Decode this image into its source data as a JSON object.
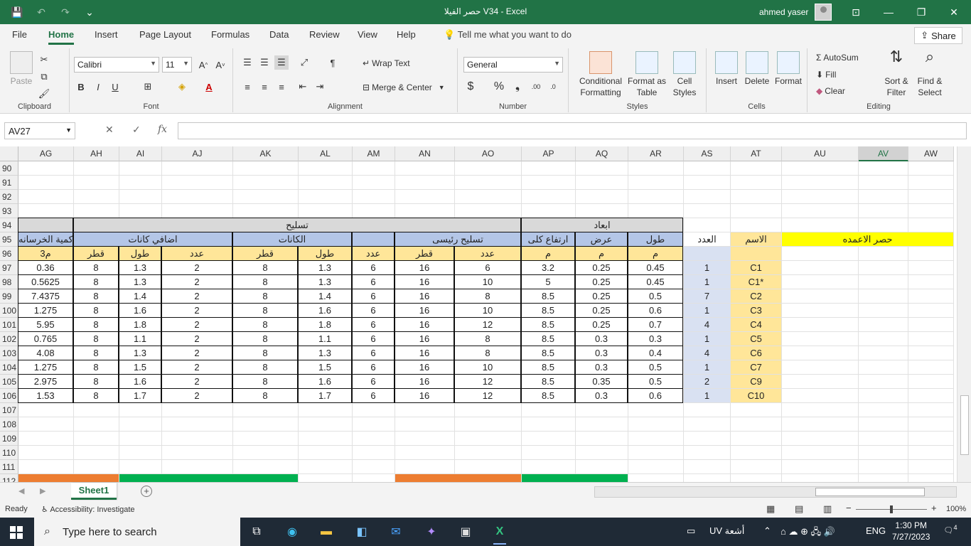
{
  "window": {
    "title": "حصر الفيلا V34  -  Excel",
    "user": "ahmed yaser",
    "minimize": "—",
    "restore": "❐",
    "close": "✕",
    "ribbon_display": "⊡"
  },
  "qat": {
    "save": "💾",
    "undo": "↶",
    "redo": "↷",
    "more": "⌄"
  },
  "menu": {
    "tabs": [
      "File",
      "Home",
      "Insert",
      "Page Layout",
      "Formulas",
      "Data",
      "Review",
      "View",
      "Help"
    ],
    "active": "Home",
    "tell_me": "Tell me what you want to do",
    "share": "Share"
  },
  "ribbon": {
    "clipboard": {
      "label": "Clipboard",
      "paste": "Paste"
    },
    "font": {
      "label": "Font",
      "name": "Calibri",
      "size": "11",
      "bold": "B",
      "italic": "I",
      "underline": "U"
    },
    "alignment": {
      "label": "Alignment",
      "wrap": "Wrap Text",
      "merge": "Merge & Center"
    },
    "number": {
      "label": "Number",
      "format": "General"
    },
    "styles": {
      "label": "Styles",
      "conditional": "Conditional",
      "conditional2": "Formatting",
      "format_as": "Format as",
      "format_as2": "Table",
      "cell": "Cell",
      "cell2": "Styles"
    },
    "cells": {
      "label": "Cells",
      "insert": "Insert",
      "delete": "Delete",
      "format": "Format"
    },
    "editing": {
      "label": "Editing",
      "autosum": "AutoSum",
      "fill": "Fill",
      "clear": "Clear",
      "sort": "Sort &",
      "sort2": "Filter",
      "find": "Find &",
      "find2": "Select"
    }
  },
  "formula_bar": {
    "name_box": "AV27",
    "fx": "fx",
    "value": ""
  },
  "columns": [
    "AG",
    "AH",
    "AI",
    "AJ",
    "AK",
    "AL",
    "AM",
    "AN",
    "AO",
    "AP",
    "AQ",
    "AR",
    "AS",
    "AT",
    "AU",
    "AV",
    "AW"
  ],
  "selected_column": "AV",
  "rows": [
    "90",
    "91",
    "92",
    "93",
    "94",
    "95",
    "96",
    "97",
    "98",
    "99",
    "100",
    "101",
    "102",
    "103",
    "104",
    "105",
    "106",
    "107",
    "108",
    "109",
    "110",
    "111",
    "112"
  ],
  "sheet": {
    "r94": {
      "reinforcement": "تسليح",
      "dimensions": "ابعاد"
    },
    "r95": {
      "concrete_qty": "كمية الخرسانه",
      "extra_stirrups": "اضافي كانات",
      "stirrups": "الكانات",
      "main_rebar": "تسليح رئيسى",
      "total_height": "ارتفاع كلى",
      "width": "عرض",
      "length": "طول",
      "count": "العدد",
      "name": "الاسم",
      "title": "حصر الاعمده"
    },
    "r96": [
      "م3",
      "قطر",
      "طول",
      "عدد",
      "قطر",
      "طول",
      "عدد",
      "قطر",
      "عدد",
      "م",
      "م",
      "م",
      "",
      ""
    ],
    "data": [
      [
        "0.36",
        "8",
        "1.3",
        "2",
        "8",
        "1.3",
        "6",
        "16",
        "6",
        "3.2",
        "0.25",
        "0.45",
        "1",
        "C1"
      ],
      [
        "0.5625",
        "8",
        "1.3",
        "2",
        "8",
        "1.3",
        "6",
        "16",
        "10",
        "5",
        "0.25",
        "0.45",
        "1",
        "C1*"
      ],
      [
        "7.4375",
        "8",
        "1.4",
        "2",
        "8",
        "1.4",
        "6",
        "16",
        "8",
        "8.5",
        "0.25",
        "0.5",
        "7",
        "C2"
      ],
      [
        "1.275",
        "8",
        "1.6",
        "2",
        "8",
        "1.6",
        "6",
        "16",
        "10",
        "8.5",
        "0.25",
        "0.6",
        "1",
        "C3"
      ],
      [
        "5.95",
        "8",
        "1.8",
        "2",
        "8",
        "1.8",
        "6",
        "16",
        "12",
        "8.5",
        "0.25",
        "0.7",
        "4",
        "C4"
      ],
      [
        "0.765",
        "8",
        "1.1",
        "2",
        "8",
        "1.1",
        "6",
        "16",
        "8",
        "8.5",
        "0.3",
        "0.3",
        "1",
        "C5"
      ],
      [
        "4.08",
        "8",
        "1.3",
        "2",
        "8",
        "1.3",
        "6",
        "16",
        "8",
        "8.5",
        "0.3",
        "0.4",
        "4",
        "C6"
      ],
      [
        "1.275",
        "8",
        "1.5",
        "2",
        "8",
        "1.5",
        "6",
        "16",
        "10",
        "8.5",
        "0.3",
        "0.5",
        "1",
        "C7"
      ],
      [
        "2.975",
        "8",
        "1.6",
        "2",
        "8",
        "1.6",
        "6",
        "16",
        "12",
        "8.5",
        "0.35",
        "0.5",
        "2",
        "C9"
      ],
      [
        "1.53",
        "8",
        "1.7",
        "2",
        "8",
        "1.7",
        "6",
        "16",
        "12",
        "8.5",
        "0.3",
        "0.6",
        "1",
        "C10"
      ]
    ]
  },
  "sheet_tabs": {
    "active": "Sheet1",
    "add": "+"
  },
  "status": {
    "ready": "Ready",
    "accessibility": "Accessibility: Investigate",
    "zoom": "100%"
  },
  "taskbar": {
    "search_placeholder": "Type here to search",
    "weather": "UV أشعة",
    "lang": "ENG",
    "time": "1:30 PM",
    "date": "7/27/2023",
    "notifications": "4"
  },
  "colors": {
    "excel_green": "#217346",
    "header_gray": "#d9d9d9",
    "header_blue": "#b4c6e7",
    "peach": "#ffe699",
    "lavender": "#d9e1f2",
    "yellow": "#ffff00",
    "orange": "#ed7d31",
    "green": "#00b050"
  }
}
